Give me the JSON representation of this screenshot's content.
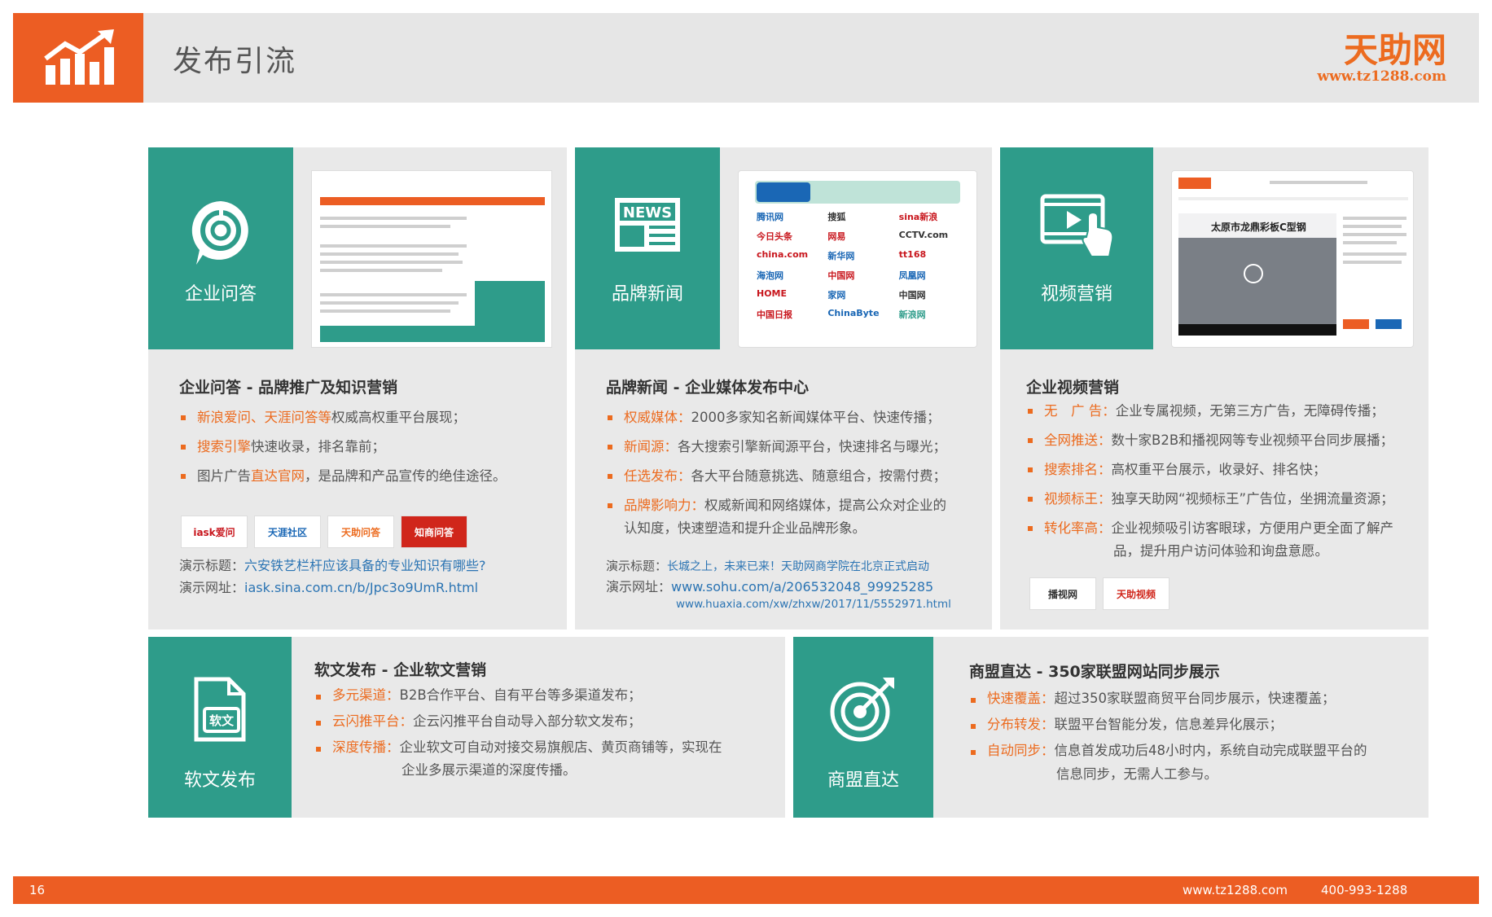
{
  "header": {
    "title": "发布引流",
    "brand_name": "天助网",
    "brand_url": "www.tz1288.com"
  },
  "cards": {
    "qa": {
      "icon_label": "企业问答",
      "title": "企业问答 - 品牌推广及知识营销",
      "bullets": [
        {
          "hl": "新浪爱问、天涯问答等",
          "text": "权威高权重平台展现；"
        },
        {
          "hl": "搜索引擎",
          "text": "快速收录，排名靠前；"
        },
        {
          "pre": "图片广告",
          "hl": "直达官网",
          "text": "，是品牌和产品宣传的绝佳途径。"
        }
      ],
      "logos": [
        "iask爱问",
        "天涯社区",
        "天助问答",
        "知商问答"
      ],
      "demo_title_label": "演示标题：",
      "demo_title": "六安铁艺栏杆应该具备的专业知识有哪些?",
      "demo_url_label": "演示网址：",
      "demo_url": "iask.sina.com.cn/b/Jpc3o9UmR.html"
    },
    "news": {
      "icon_label": "品牌新闻",
      "icon_text": "NEWS",
      "title": "品牌新闻 - 企业媒体发布中心",
      "bullets": [
        {
          "hl": "权威媒体：",
          "text": "2000多家知名新闻媒体平台、快速传播；"
        },
        {
          "hl": "新闻源：",
          "text": "各大搜索引擎新闻源平台，快速排名与曝光；"
        },
        {
          "hl": "任选发布：",
          "text": "各大平台随意挑选、随意组合，按需付费；"
        },
        {
          "hl": "品牌影响力：",
          "text": "权威新闻和网络媒体，提高公众对企业的",
          "cont": "认知度，快速塑造和提升企业品牌形象。"
        }
      ],
      "media_logos": [
        "腾讯网",
        "搜狐",
        "sina新浪",
        "今日头条",
        "网易",
        "CCTV.com",
        "china.com",
        "新华网",
        "tt168",
        "海泡网",
        "中国网",
        "凤凰网",
        "HOME",
        "家网",
        "中国网",
        "中国日报",
        "ChinaByte",
        "新浪网"
      ],
      "demo_title_label": "演示标题：",
      "demo_title": "长城之上，未来已来！天助网商学院在北京正式启动",
      "demo_url_label": "演示网址：",
      "demo_url": "www.sohu.com/a/206532048_99925285",
      "demo_url2": "www.huaxia.com/xw/zhxw/2017/11/5552971.html"
    },
    "video": {
      "icon_label": "视频营销",
      "title": "企业视频营销",
      "bullets": [
        {
          "hl": "无　广 告：",
          "text": "企业专属视频，无第三方广告，无障碍传播；"
        },
        {
          "hl": "全网推送：",
          "text": "数十家B2B和播视网等专业视频平台同步展播；"
        },
        {
          "hl": "搜索排名：",
          "text": "高权重平台展示，收录好、排名快；"
        },
        {
          "hl": "视频标王：",
          "text": "独享天助网“视频标王”广告位，坐拥流量资源；"
        },
        {
          "hl": "转化率高：",
          "text": "企业视频吸引访客眼球，方便用户更全面了解产",
          "cont": "品，提升用户访问体验和询盘意愿。"
        }
      ],
      "logos": [
        "播视网",
        "天助视频"
      ],
      "thumb_caption": "太原市龙鼎彩板C型钢"
    },
    "soft": {
      "icon_label": "软文发布",
      "icon_text": "软文",
      "title": "软文发布 - 企业软文营销",
      "bullets": [
        {
          "hl": "多元渠道：",
          "text": "B2B合作平台、自有平台等多渠道发布；"
        },
        {
          "hl": "云闪推平台：",
          "text": "企云闪推平台自动导入部分软文发布；"
        },
        {
          "hl": "深度传播：",
          "text": "企业软文可自动对接交易旗舰店、黄页商铺等，实现在",
          "cont": "企业多展示渠道的深度传播。"
        }
      ]
    },
    "union": {
      "icon_label": "商盟直达",
      "title": "商盟直达 - 350家联盟网站同步展示",
      "bullets": [
        {
          "hl": "快速覆盖：",
          "text": "超过350家联盟商贸平台同步展示，快速覆盖；"
        },
        {
          "hl": "分布转发：",
          "text": "联盟平台智能分发，信息差异化展示；"
        },
        {
          "hl": "自动同步：",
          "text": "信息首发成功后48小时内，系统自动完成联盟平台的",
          "cont": "信息同步，无需人工参与。"
        }
      ]
    }
  },
  "footer": {
    "page_number": "16",
    "url": "www.tz1288.com",
    "phone": "400-993-1288"
  },
  "colors": {
    "orange": "#ec5d23",
    "teal": "#2e9c8a",
    "card_bg": "#e9e9e9"
  }
}
